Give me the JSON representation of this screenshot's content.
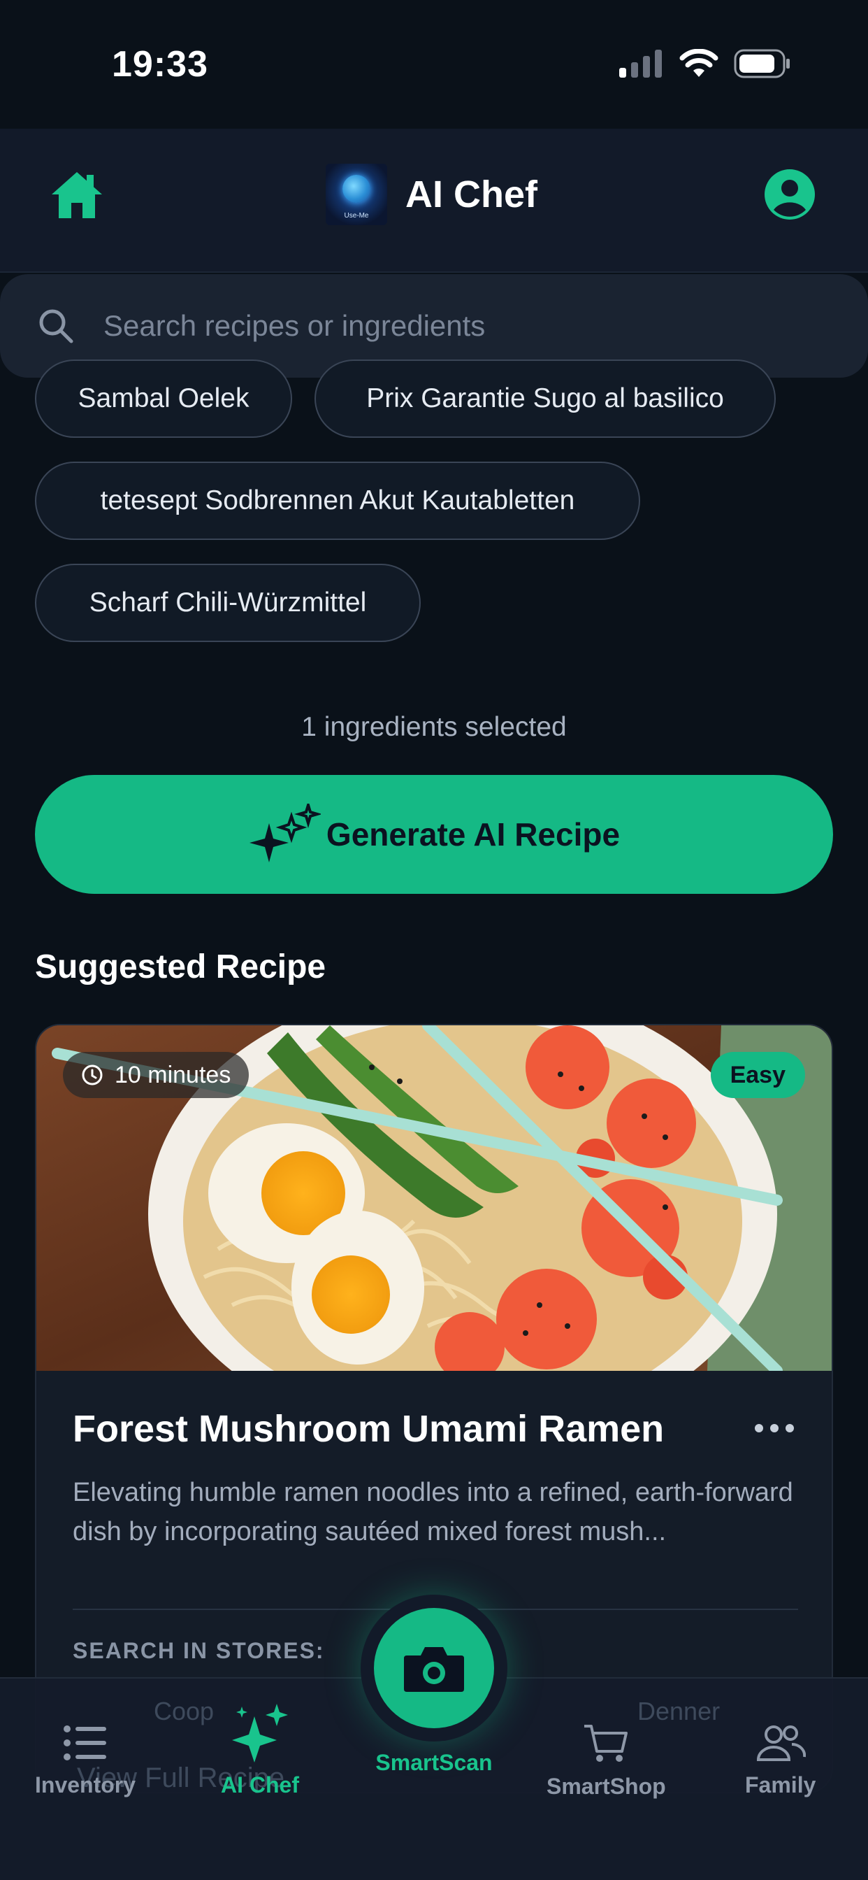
{
  "status_bar": {
    "time": "19:33"
  },
  "header": {
    "title": "AI Chef",
    "logo_text": "Use-Me"
  },
  "search": {
    "placeholder": "Search recipes or ingredients"
  },
  "chips": [
    "Sambal Oelek",
    "Prix Garantie Sugo al basilico",
    "tetesept Sodbrennen Akut Kautabletten",
    "Scharf Chili-Würzmittel"
  ],
  "selection": {
    "count_text": "1 ingredients selected"
  },
  "generate_button": {
    "label": "Generate AI Recipe"
  },
  "suggested": {
    "section_title": "Suggested Recipe",
    "recipe": {
      "time": "10 minutes",
      "difficulty": "Easy",
      "title": "Forest Mushroom Umami Ramen",
      "description": "Elevating humble ramen noodles into a refined, earth-forward dish by incorporating sautéed mixed forest mush...",
      "stores_label": "SEARCH IN STORES:",
      "stores": [
        "Coop",
        "Denner"
      ],
      "view_link": "View Full Recipe"
    }
  },
  "nav": {
    "items": [
      {
        "label": "Inventory",
        "icon": "list-icon"
      },
      {
        "label": "AI Chef",
        "icon": "sparkle-icon",
        "active": true
      },
      {
        "label": "SmartScan",
        "icon": "camera-icon"
      },
      {
        "label": "SmartShop",
        "icon": "cart-icon"
      },
      {
        "label": "Family",
        "icon": "people-icon"
      }
    ]
  },
  "colors": {
    "accent": "#15b985",
    "background": "#0a1119",
    "header": "#121a29"
  }
}
